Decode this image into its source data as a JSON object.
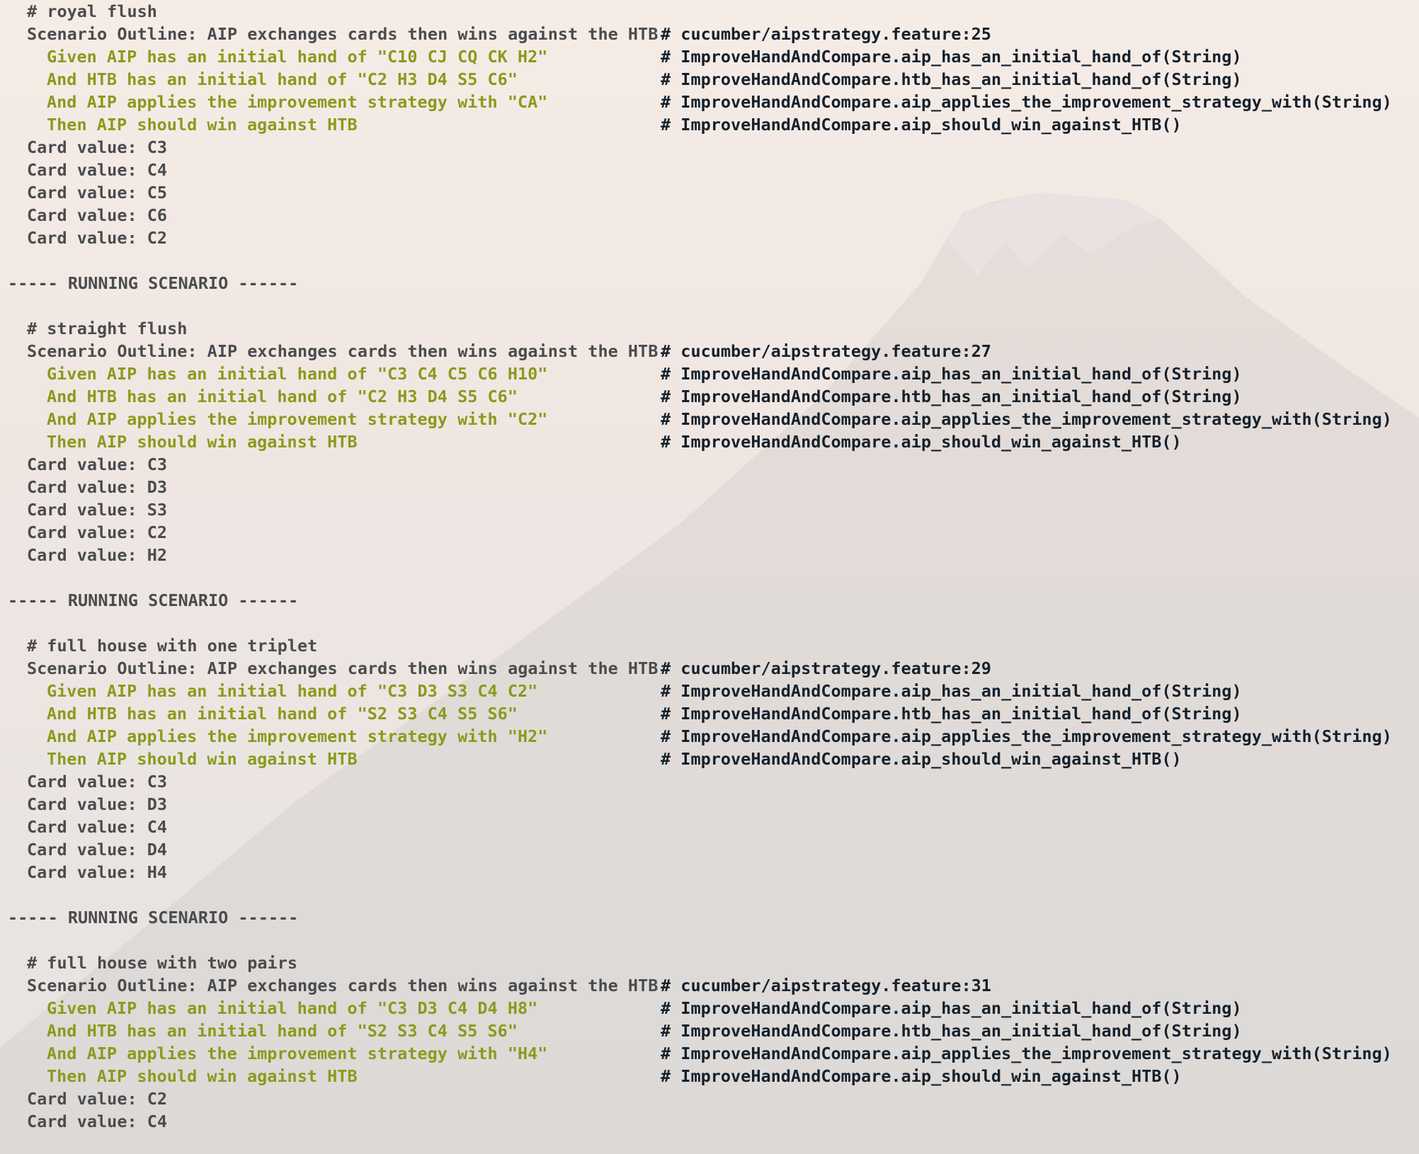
{
  "divider": "----- RUNNING SCENARIO ------",
  "outline_prefix": "Scenario Outline: AIP exchanges cards then wins against the HTB",
  "step_defs": {
    "given": "# ImproveHandAndCompare.aip_has_an_initial_hand_of(String)",
    "and_htb": "# ImproveHandAndCompare.htb_has_an_initial_hand_of(String)",
    "and_strategy": "# ImproveHandAndCompare.aip_applies_the_improvement_strategy_with(String)",
    "then": "# ImproveHandAndCompare.aip_should_win_against_HTB()"
  },
  "scenarios": [
    {
      "comment": "# royal flush",
      "location": "# cucumber/aipstrategy.feature:25",
      "given": "Given AIP has an initial hand of \"C10 CJ CQ CK H2\"",
      "and_htb": "And HTB has an initial hand of \"C2 H3 D4 S5 C6\"",
      "and_strategy": "And AIP applies the improvement strategy with \"CA\"",
      "then": "Then AIP should win against HTB",
      "cards": [
        "Card value: C3",
        "Card value: C4",
        "Card value: C5",
        "Card value: C6",
        "Card value: C2"
      ]
    },
    {
      "comment": "# straight flush",
      "location": "# cucumber/aipstrategy.feature:27",
      "given": "Given AIP has an initial hand of \"C3 C4 C5 C6 H10\"",
      "and_htb": "And HTB has an initial hand of \"C2 H3 D4 S5 C6\"",
      "and_strategy": "And AIP applies the improvement strategy with \"C2\"",
      "then": "Then AIP should win against HTB",
      "cards": [
        "Card value: C3",
        "Card value: D3",
        "Card value: S3",
        "Card value: C2",
        "Card value: H2"
      ]
    },
    {
      "comment": "# full house with one triplet",
      "location": "# cucumber/aipstrategy.feature:29",
      "given": "Given AIP has an initial hand of \"C3 D3 S3 C4 C2\"",
      "and_htb": "And HTB has an initial hand of \"S2 S3 C4 S5 S6\"",
      "and_strategy": "And AIP applies the improvement strategy with \"H2\"",
      "then": "Then AIP should win against HTB",
      "cards": [
        "Card value: C3",
        "Card value: D3",
        "Card value: C4",
        "Card value: D4",
        "Card value: H4"
      ]
    },
    {
      "comment": "# full house with two pairs",
      "location": "# cucumber/aipstrategy.feature:31",
      "given": "Given AIP has an initial hand of \"C3 D3 C4 D4 H8\"",
      "and_htb": "And HTB has an initial hand of \"S2 S3 C4 S5 S6\"",
      "and_strategy": "And AIP applies the improvement strategy with \"H4\"",
      "then": "Then AIP should win against HTB",
      "cards": [
        "Card value: C2",
        "Card value: C4"
      ]
    }
  ]
}
